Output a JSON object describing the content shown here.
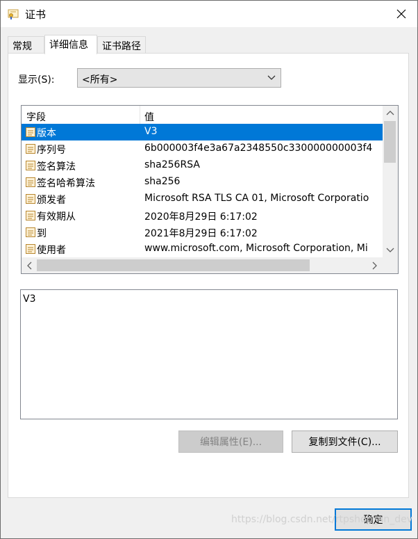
{
  "window": {
    "title": "证书"
  },
  "tabs": [
    {
      "label": "常规"
    },
    {
      "label": "详细信息"
    },
    {
      "label": "证书路径"
    }
  ],
  "show": {
    "label": "显示(S):",
    "selected": "<所有>"
  },
  "list": {
    "columns": {
      "field": "字段",
      "value": "值"
    },
    "rows": [
      {
        "field": "版本",
        "value": "V3"
      },
      {
        "field": "序列号",
        "value": "6b000003f4e3a67a2348550c330000000003f4"
      },
      {
        "field": "签名算法",
        "value": "sha256RSA"
      },
      {
        "field": "签名哈希算法",
        "value": "sha256"
      },
      {
        "field": "颁发者",
        "value": "Microsoft RSA TLS CA 01, Microsoft Corporatio"
      },
      {
        "field": "有效期从",
        "value": "2020年8月29日 6:17:02"
      },
      {
        "field": "到",
        "value": "2021年8月29日 6:17:02"
      },
      {
        "field": "使用者",
        "value": "www.microsoft.com, Microsoft Corporation, Mi"
      }
    ]
  },
  "detail": {
    "text": "V3"
  },
  "buttons": {
    "edit": "编辑属性(E)...",
    "copy": "复制到文件(C)...",
    "ok": "确定"
  },
  "watermark": "https://blog.csdn.net/rtpshop_nn_dev",
  "colors": {
    "selection": "#0078d7",
    "default_button_border": "#0078d7"
  }
}
